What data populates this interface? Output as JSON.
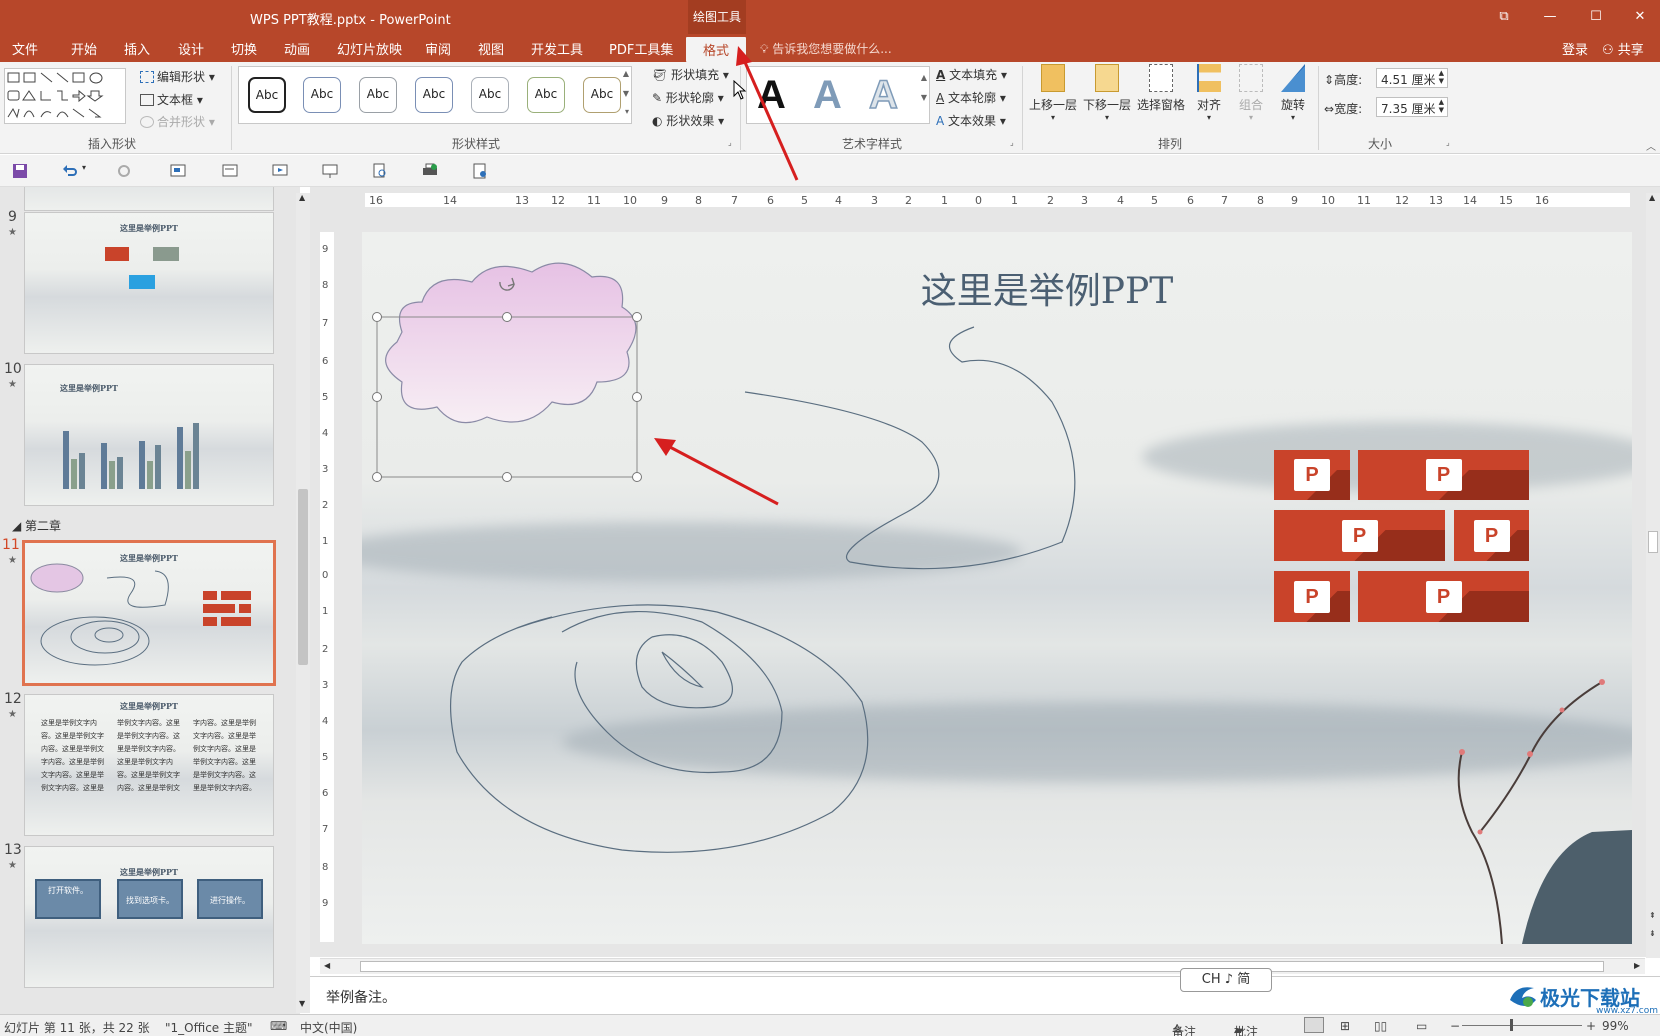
{
  "window": {
    "title": "WPS PPT教程.pptx - PowerPoint",
    "context_tab_group": "绘图工具"
  },
  "tabs": [
    "文件",
    "开始",
    "插入",
    "设计",
    "切换",
    "动画",
    "幻灯片放映",
    "审阅",
    "视图",
    "开发工具",
    "PDF工具集",
    "格式"
  ],
  "active_tab": "格式",
  "tell_me": "告诉我您想要做什么...",
  "account": {
    "login": "登录",
    "share": "共享"
  },
  "ribbon": {
    "insert_shapes": {
      "label": "插入形状",
      "edit_shape": "编辑形状",
      "text_box": "文本框",
      "merge_shapes": "合并形状"
    },
    "shape_styles": {
      "label": "形状样式",
      "swatch_text": "Abc",
      "fill": "形状填充",
      "outline": "形状轮廓",
      "effects": "形状效果"
    },
    "wordart": {
      "label": "艺术字样式",
      "letter": "A",
      "text_fill": "文本填充",
      "text_outline": "文本轮廓",
      "text_effects": "文本效果"
    },
    "arrange": {
      "label": "排列",
      "bring_forward": "上移一层",
      "send_backward": "下移一层",
      "selection_pane": "选择窗格",
      "align": "对齐",
      "group": "组合",
      "rotate": "旋转"
    },
    "size": {
      "label": "大小",
      "height_label": "高度:",
      "height_value": "4.51 厘米",
      "width_label": "宽度:",
      "width_value": "7.35 厘米"
    }
  },
  "thumbnails": {
    "s9": {
      "num": "9",
      "title": "这里是举例PPT"
    },
    "s10": {
      "num": "10",
      "title": "这里是举例PPT"
    },
    "section": "第二章",
    "s11": {
      "num": "11",
      "title": "这里是举例PPT"
    },
    "s12": {
      "num": "12",
      "title": "这里是举例PPT",
      "body": "这里是举例文字内容。这里是举例文字内容。这里是举例文字内容。这里是举例文字内容。这里是举例文字内容。这里是举例文字内容。这里是举例文字内容。这里是举例文字内容。这里是举例文字内容。这里是举例文字内容。这里是举例文字内容。这里是举例文字内容。这里是举例文字内容。这里是举例文字内容。这里是举例文字内容。这里是举例文字内容。"
    },
    "s13": {
      "num": "13",
      "title": "这里是举例PPT",
      "box1": "打开软件。",
      "box2": "找到选项卡。",
      "box3": "进行操作。"
    }
  },
  "slide": {
    "title": "这里是举例PPT",
    "tile_letter": "P"
  },
  "notes": "举例备注。",
  "ime": "CH ♪ 简",
  "status": {
    "slide_info": "幻灯片 第 11 张，共 22 张",
    "theme": "\"1_Office 主题\"",
    "language": "中文(中国)",
    "notes_btn": "备注",
    "comments_btn": "批注",
    "zoom": "99%"
  },
  "watermark": {
    "text": "极光下载站",
    "url": "www.xz7.com"
  },
  "colors": {
    "accent": "#b7472a",
    "selected_thumb_border": "#e0734f",
    "arrow": "#d61f1f"
  }
}
